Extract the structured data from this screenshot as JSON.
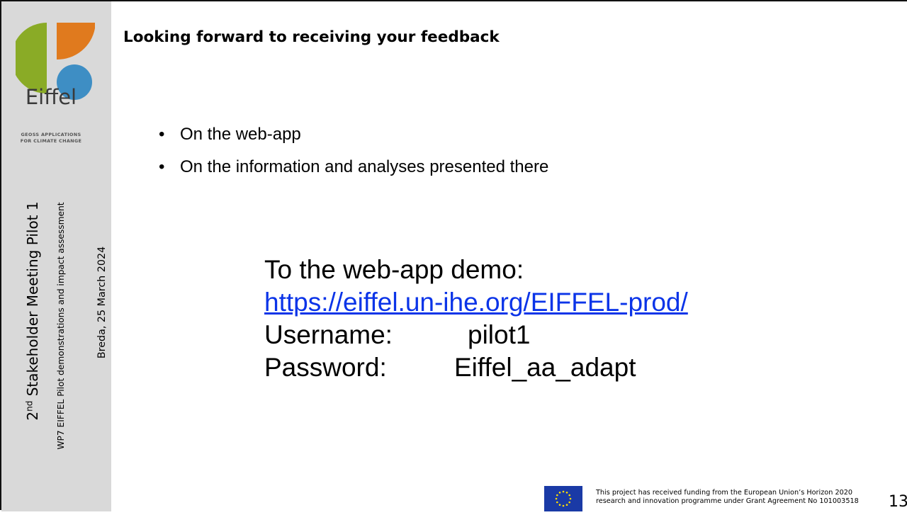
{
  "sidebar": {
    "logo": {
      "name": "Eiffel",
      "tagline_line1": "GEOSS APPLICATIONS",
      "tagline_line2": "FOR CLIMATE CHANGE",
      "colors": {
        "green": "#8aab26",
        "orange": "#e07a1e",
        "blue": "#3e8ec4"
      }
    },
    "meeting_prefix": "2",
    "meeting_sup": "nd",
    "meeting_rest": " Stakeholder Meeting Pilot 1",
    "workpackage": "WP7 EIFFEL Pilot demonstrations and impact assessment",
    "place_date": "Breda, 25 March 2024"
  },
  "slide": {
    "title": "Looking forward to receiving your feedback",
    "bullets": [
      {
        "marker": "•",
        "text": "On the web-app"
      },
      {
        "marker": "•",
        "text": "On the information and analyses presented there"
      }
    ],
    "demo": {
      "heading": "To the web-app demo:",
      "link": "https://eiffel.un-ihe.org/EIFFEL-prod/",
      "username_label": "Username:",
      "username_value": "pilot1",
      "password_label": "Password:",
      "password_value": "Eiffel_aa_adapt"
    }
  },
  "footer": {
    "funding_line1": "This project has received funding from the European Union’s Horizon 2020",
    "funding_line2": "research and innovation programme under Grant Agreement No 101003518",
    "page_number": "13",
    "eu_flag_icon": "eu-flag-icon"
  }
}
